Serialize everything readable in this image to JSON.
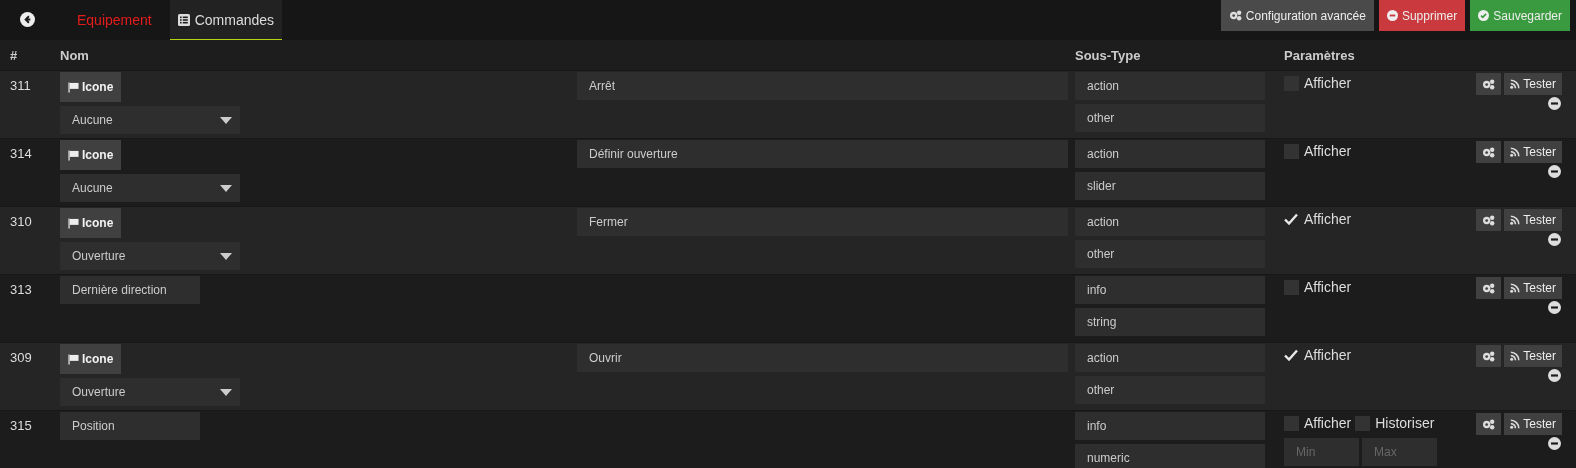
{
  "tabs": [
    {
      "label": "Equipement",
      "selected": false
    },
    {
      "label": "Commandes",
      "selected": true
    }
  ],
  "actions": [
    {
      "label": "Configuration avancée",
      "kind": "config"
    },
    {
      "label": "Supprimer",
      "kind": "delete"
    },
    {
      "label": "Sauvegarder",
      "kind": "save"
    }
  ],
  "table": {
    "columns": [
      "#",
      "Nom",
      "Sous-Type",
      "Paramètres"
    ],
    "rows": [
      {
        "id": "311",
        "kind": "action",
        "icon_button": "Icone",
        "value": "Aucune",
        "name": "Arrêt",
        "type": "action",
        "subtype": "other",
        "options": [
          {
            "label": "Afficher",
            "checked": false
          }
        ],
        "test_button": "Tester"
      },
      {
        "id": "314",
        "kind": "action",
        "icon_button": "Icone",
        "value": "Aucune",
        "name": "Définir ouverture",
        "type": "action",
        "subtype": "slider",
        "options": [
          {
            "label": "Afficher",
            "checked": false
          }
        ],
        "test_button": "Tester"
      },
      {
        "id": "310",
        "kind": "action",
        "icon_button": "Icone",
        "value": "Ouverture",
        "name": "Fermer",
        "type": "action",
        "subtype": "other",
        "options": [
          {
            "label": "Afficher",
            "checked": true
          }
        ],
        "test_button": "Tester"
      },
      {
        "id": "313",
        "kind": "info",
        "name": "Dernière direction",
        "type": "info",
        "subtype": "string",
        "options": [
          {
            "label": "Afficher",
            "checked": false
          }
        ],
        "test_button": "Tester"
      },
      {
        "id": "309",
        "kind": "action",
        "icon_button": "Icone",
        "value": "Ouverture",
        "name": "Ouvrir",
        "type": "action",
        "subtype": "other",
        "options": [
          {
            "label": "Afficher",
            "checked": true
          }
        ],
        "test_button": "Tester"
      },
      {
        "id": "315",
        "kind": "info",
        "name": "Position",
        "type": "info",
        "subtype": "numeric",
        "options": [
          {
            "label": "Afficher",
            "checked": false
          },
          {
            "label": "Historiser",
            "checked": false
          }
        ],
        "min_placeholder": "Min",
        "max_placeholder": "Max",
        "test_button": "Tester"
      }
    ]
  }
}
